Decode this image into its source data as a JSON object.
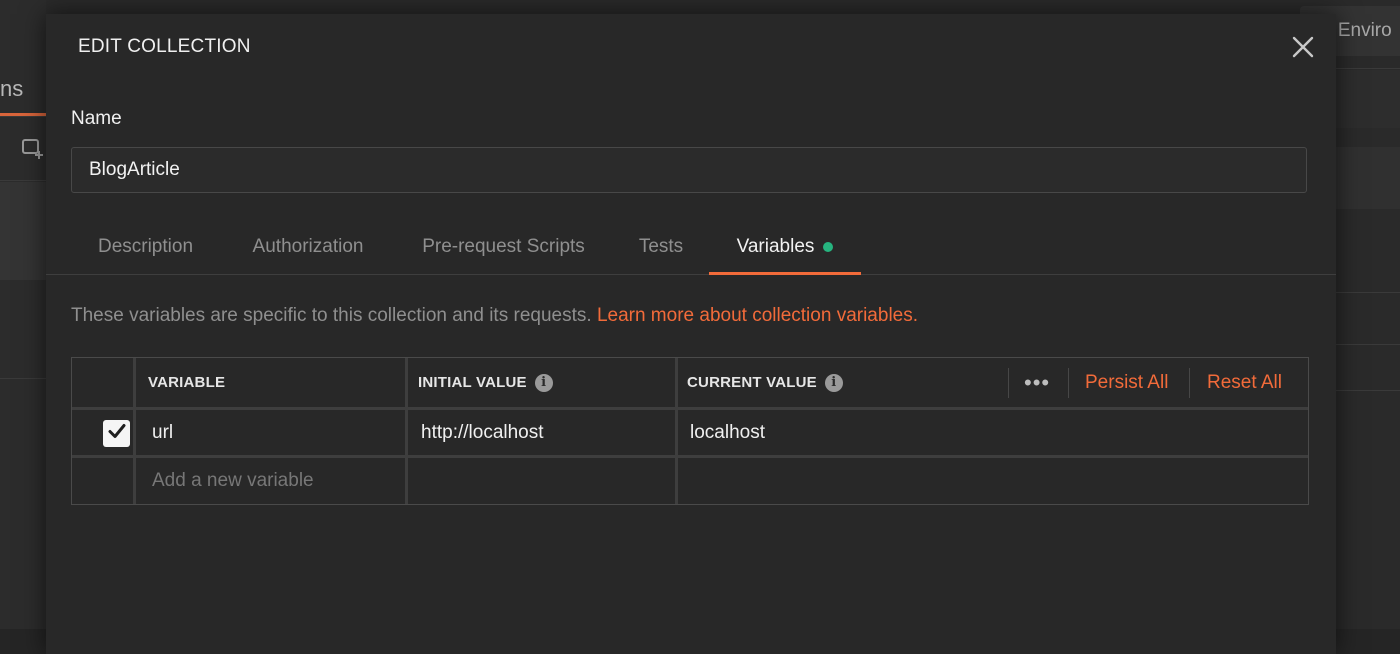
{
  "background": {
    "left_tab_text": "ns",
    "right_env_text": "o Enviro"
  },
  "modal": {
    "title": "EDIT COLLECTION",
    "name_label": "Name",
    "name_value": "BlogArticle",
    "tabs": [
      {
        "label": "Description"
      },
      {
        "label": "Authorization"
      },
      {
        "label": "Pre-request Scripts"
      },
      {
        "label": "Tests"
      },
      {
        "label": "Variables",
        "active": true
      }
    ],
    "variables": {
      "info_text": "These variables are specific to this collection and its requests.",
      "learn_more_link": "Learn more about collection variables.",
      "columns": {
        "variable": "VARIABLE",
        "initial_value": "INITIAL VALUE",
        "current_value": "CURRENT VALUE"
      },
      "more_label": "•••",
      "persist_all": "Persist All",
      "reset_all": "Reset All",
      "rows": [
        {
          "enabled": true,
          "variable": "url",
          "initial_value": "http://localhost",
          "current_value": "localhost"
        }
      ],
      "new_row_placeholder": "Add a new variable"
    }
  },
  "colors": {
    "accent": "#f26b3a",
    "status_dot": "#26b47f",
    "background": "#282828"
  },
  "icons": [
    "close-icon",
    "info-icon",
    "checkmark-icon",
    "more-icon",
    "new-collection-icon"
  ]
}
